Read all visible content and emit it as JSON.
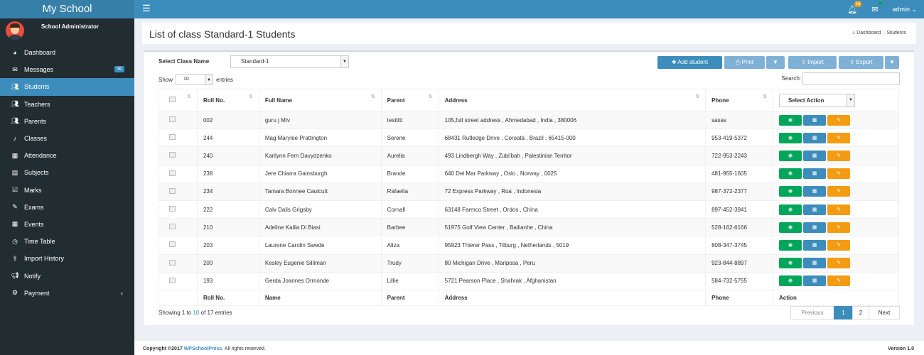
{
  "header": {
    "brand": "My School",
    "hamburger_icon": "☰",
    "notif_count": "16",
    "user": "admin ⌄"
  },
  "sidebar": {
    "user_name": "School Administrator",
    "items": [
      {
        "label": "Dashboard",
        "icon": "dashboard-icon"
      },
      {
        "label": "Messages",
        "icon": "envelope-icon",
        "badge": "✉"
      },
      {
        "label": "Students",
        "icon": "users-icon",
        "active": true
      },
      {
        "label": "Teachers",
        "icon": "users-icon"
      },
      {
        "label": "Parents",
        "icon": "users-icon"
      },
      {
        "label": "Classes",
        "icon": "bell-icon"
      },
      {
        "label": "Attendance",
        "icon": "table-icon"
      },
      {
        "label": "Subjects",
        "icon": "book-icon"
      },
      {
        "label": "Marks",
        "icon": "check-square-icon"
      },
      {
        "label": "Exams",
        "icon": "edit-icon"
      },
      {
        "label": "Events",
        "icon": "calendar-icon"
      },
      {
        "label": "Time Table",
        "icon": "clock-icon"
      },
      {
        "label": "Import History",
        "icon": "upload-icon"
      },
      {
        "label": "Notify",
        "icon": "bullhorn-icon"
      },
      {
        "label": "Payment",
        "icon": "gear-icon",
        "chevron": "‹"
      }
    ]
  },
  "page": {
    "title": "List of class Standard-1 Students",
    "breadcrumb": [
      "Dashboard",
      "Students"
    ]
  },
  "toolbar": {
    "select_class_label": "Select Class Name",
    "select_class_value": "Standard-1",
    "add_student": "Add student",
    "print": "Print",
    "import": "Import",
    "export": "Export"
  },
  "table_controls": {
    "show": "Show",
    "entries_value": "10",
    "entries": "entries",
    "search": "Search:"
  },
  "table": {
    "headers": [
      "Roll No.",
      "Full Name",
      "Parent",
      "Address",
      "Phone"
    ],
    "select_action": "Select Action",
    "footer": [
      "Roll No.",
      "Name",
      "Parent",
      "Address",
      "Phone",
      "Action"
    ],
    "rows": [
      [
        "002",
        "guru j Mtv",
        "testtttt",
        "105,full street address , Ahmedabad , India , 380006",
        "sasas"
      ],
      [
        "244",
        "Mag Marylee Prattington",
        "Serene",
        "68431 Rutledge Drive , Coroatá , Brazil , 65415-000",
        "953-419-5372"
      ],
      [
        "240",
        "Karilynn Fern Davydzenko",
        "Aurelia",
        "493 Lindbergh Way , Zubi'bah , Palestinian Territor",
        "722-953-2243"
      ],
      [
        "238",
        "Jere Chiarra Gainsburgh",
        "Brande",
        "640 Del Mar Parkway , Oslo , Norway , 0025",
        "481-955-1605"
      ],
      [
        "234",
        "Tamara Bonnee Caulcutt",
        "Rafaelia",
        "72 Express Parkway , Roa , Indonesia",
        "987-372-2377"
      ],
      [
        "222",
        "Calv Dalis Grigsby",
        "Cornall",
        "63148 Farmco Street , Ordos , China",
        "897-452-3941"
      ],
      [
        "210",
        "Adeline Kalila Di Biasi",
        "Barbee",
        "51975 Golf View Center , Bailianhe , China",
        "528-162-6166"
      ],
      [
        "203",
        "Laurene Carolin Swede",
        "Aliza",
        "95923 Thierer Pass , Tilburg , Netherlands , 5019",
        "808-347-3745"
      ],
      [
        "200",
        "Kesley Eugenie Silliman",
        "Trudy",
        "80 Michigan Drive , Mariposa , Peru",
        "923-844-8897"
      ],
      [
        "193",
        "Gerda Joannes Ormonde",
        "Lillie",
        "5721 Pearson Place , Shahrak , Afghanistan",
        "584-732-5755"
      ]
    ]
  },
  "pagination": {
    "info_prefix": "Showing 1 to ",
    "info_link": "10",
    "info_suffix": " of 17 entries",
    "previous": "Previous",
    "pages": [
      "1",
      "2"
    ],
    "next": "Next"
  },
  "footer": {
    "copyright_prefix": "Copyright ©2017 ",
    "copyright_link": "WPSchoolPress",
    "copyright_suffix": ". All rights reserved.",
    "version": "Version 1.0"
  }
}
